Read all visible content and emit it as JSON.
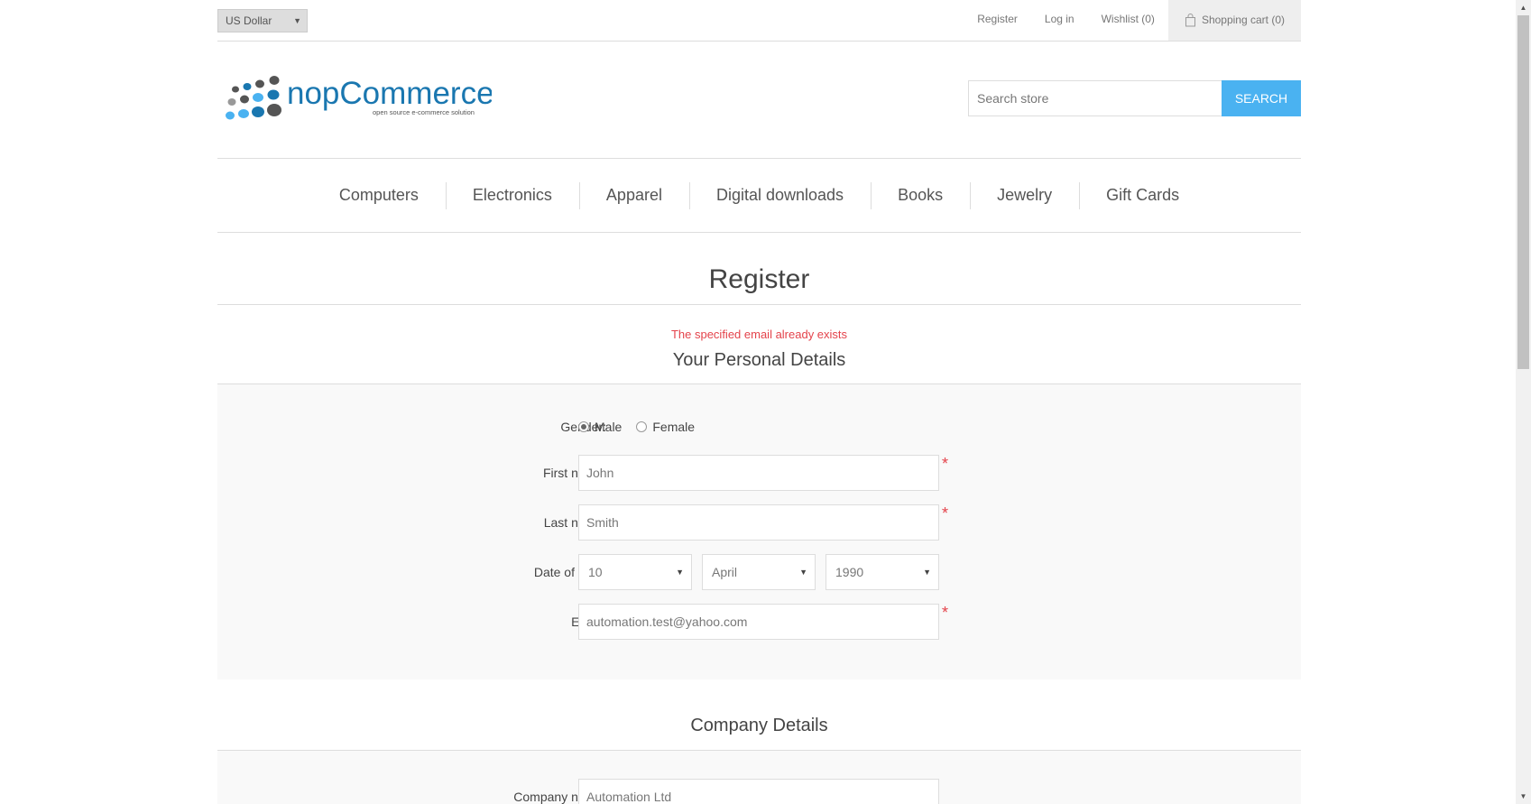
{
  "header": {
    "currency": "US Dollar",
    "links": {
      "register": "Register",
      "login": "Log in",
      "wishlist": "Wishlist (0)",
      "cart": "Shopping cart (0)"
    }
  },
  "logo": {
    "name": "nopCommerce",
    "tagline": "open source e-commerce solution"
  },
  "search": {
    "placeholder": "Search store",
    "button": "SEARCH"
  },
  "menu": {
    "items": [
      "Computers",
      "Electronics",
      "Apparel",
      "Digital downloads",
      "Books",
      "Jewelry",
      "Gift Cards"
    ]
  },
  "page": {
    "title": "Register",
    "error": "The specified email already exists"
  },
  "personal": {
    "title": "Your Personal Details",
    "gender_label": "Gender:",
    "gender_male": "Male",
    "gender_female": "Female",
    "gender_selected": "Male",
    "first_name_label": "First name:",
    "first_name_value": "John",
    "last_name_label": "Last name:",
    "last_name_value": "Smith",
    "dob_label": "Date of birth:",
    "dob_day": "10",
    "dob_month": "April",
    "dob_year": "1990",
    "email_label": "Email:",
    "email_value": "automation.test@yahoo.com",
    "required_mark": "*"
  },
  "company": {
    "title": "Company Details",
    "name_label": "Company name:",
    "name_value": "Automation Ltd"
  },
  "colors": {
    "accent": "#4ab2f1",
    "error": "#e4434b",
    "panel": "#f9f9f9"
  }
}
